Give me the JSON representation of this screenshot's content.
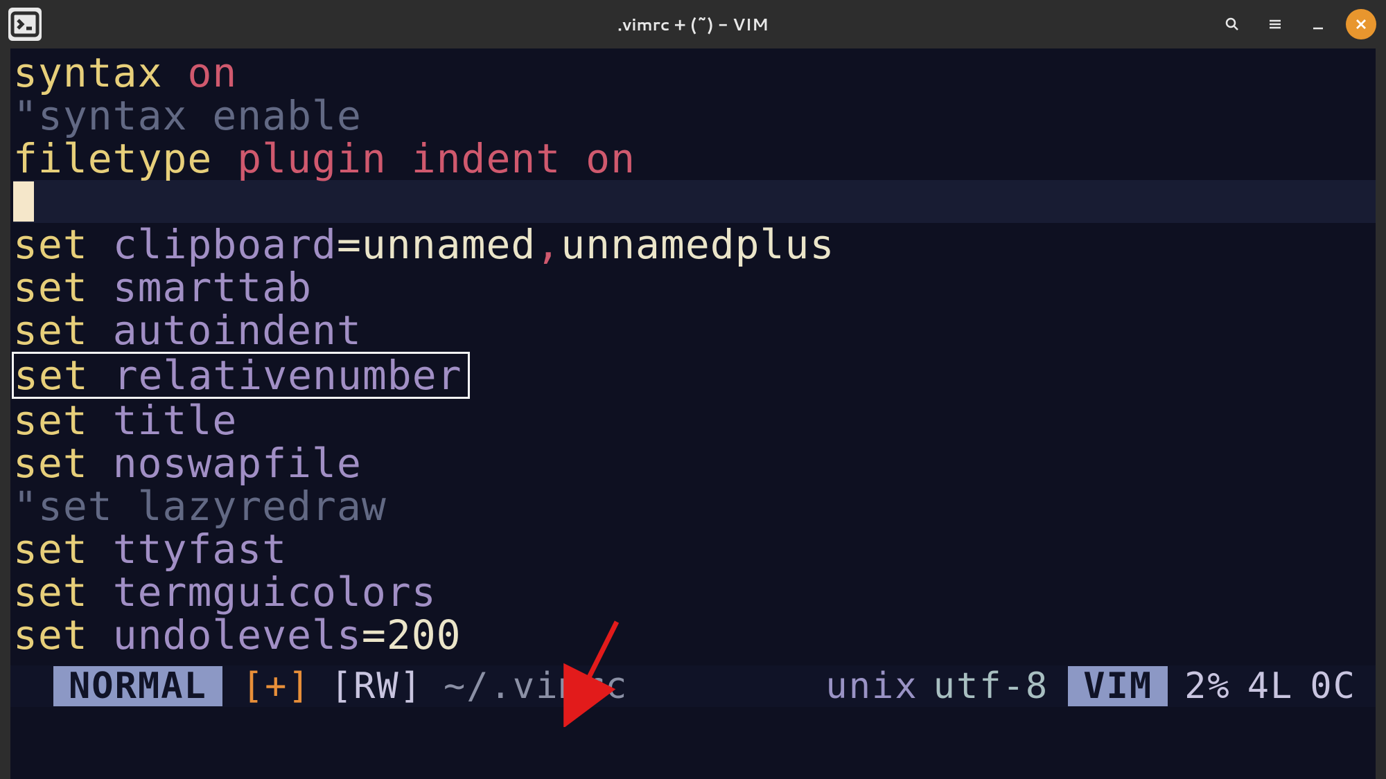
{
  "window": {
    "title": ".vimrc + (~) - VIM"
  },
  "lines": {
    "l1a": "syntax",
    "l1b": "on",
    "l2a": "\"",
    "l2b": "syntax enable",
    "l3a": "filetype",
    "l3b": "plugin",
    "l3c": "indent",
    "l3d": "on",
    "l5a": "set",
    "l5b": "clipboard",
    "l5c": "=",
    "l5d": "unnamed",
    "l5e": ",",
    "l5f": "unnamedplus",
    "l6a": "set",
    "l6b": "smarttab",
    "l7a": "set",
    "l7b": "autoindent",
    "l8a": "set",
    "l8b": "relativenumber",
    "l9a": "set",
    "l9b": "title",
    "l10a": "set",
    "l10b": "noswapfile",
    "l11a": "\"",
    "l11b": "set lazyredraw",
    "l12a": "set",
    "l12b": "ttyfast",
    "l13a": "set",
    "l13b": "termguicolors",
    "l14a": "set",
    "l14b": "undolevels",
    "l14c": "=",
    "l14d": "200"
  },
  "statusline": {
    "mode": "NORMAL",
    "modified": "[+]",
    "rw": "[RW]",
    "path": "~/.vimrc",
    "format": "unix",
    "encoding": "utf-8",
    "filetype": "VIM",
    "percent": "2%",
    "line": "4L",
    "col": "0C"
  },
  "annotations": {
    "arrow_target": "statusline-filepath"
  }
}
